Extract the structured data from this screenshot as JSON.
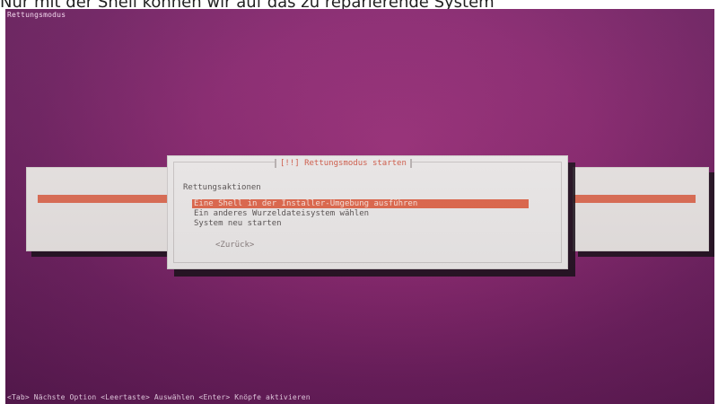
{
  "page": {
    "caption": "Nur mit der Shell können wir auf das zu reparierende System"
  },
  "screen": {
    "title": "Rettungsmodus",
    "footer": "<Tab> Nächste Option <Leertaste> Auswählen <Enter> Knöpfe aktivieren"
  },
  "dialog": {
    "title": "[!!] Rettungsmodus starten",
    "label": "Rettungsaktionen",
    "options": [
      "Eine Shell in der Installer-Umgebung ausführen",
      "Ein anderes Wurzeldateisystem wählen",
      "System neu starten"
    ],
    "selected_index": 0,
    "back_label": "<Zurück>"
  },
  "colors": {
    "background": "#8a2770",
    "panel": "#f1eeee",
    "highlight": "#e4694e",
    "title_text": "#d55d4b"
  }
}
